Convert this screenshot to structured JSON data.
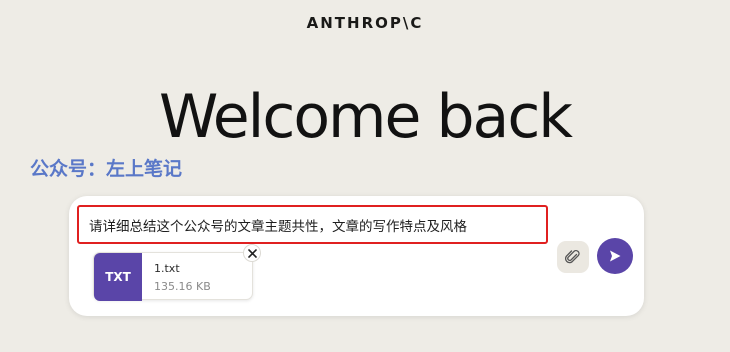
{
  "header": {
    "logo_text": "ANTHROP\\C"
  },
  "main": {
    "greeting": "Welcome back"
  },
  "watermark": {
    "text": "公众号：左上笔记"
  },
  "composer": {
    "prompt_text": "请详细总结这个公众号的文章主题共性，文章的写作特点及风格",
    "attachment": {
      "type_label": "TXT",
      "filename": "1.txt",
      "size": "135.16 KB",
      "remove_icon": "close-icon"
    },
    "attach_icon": "paperclip-icon",
    "send_icon": "send-arrow-icon"
  },
  "colors": {
    "background": "#eeece6",
    "accent": "#5a45a8",
    "watermark": "#5a78c8",
    "highlight_border": "#e02020"
  }
}
